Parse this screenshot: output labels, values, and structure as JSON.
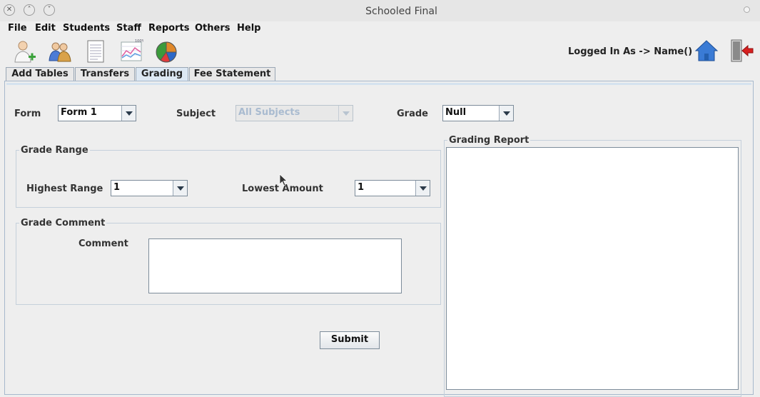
{
  "window": {
    "title": "Schooled Final"
  },
  "menu": [
    "File",
    "Edit",
    "Students",
    "Staff",
    "Reports",
    "Others",
    "Help"
  ],
  "toolbar": {
    "icons": [
      "add-user-icon",
      "users-icon",
      "document-icon",
      "chart-icon",
      "pie-chart-icon"
    ],
    "logged_in": "Logged In As -> Name()"
  },
  "tabs": [
    "Add Tables",
    "Transfers",
    "Grading",
    "Fee Statement"
  ],
  "active_tab": "Grading",
  "filters": {
    "form_label": "Form",
    "form_value": "Form 1",
    "subject_label": "Subject",
    "subject_value": "All Subjects",
    "grade_label": "Grade",
    "grade_value": "Null"
  },
  "grade_range": {
    "title": "Grade Range",
    "highest_label": "Highest Range",
    "highest_value": "1",
    "lowest_label": "Lowest Amount",
    "lowest_value": "1"
  },
  "grade_comment": {
    "title": "Grade Comment",
    "comment_label": "Comment",
    "comment_value": ""
  },
  "submit_label": "Submit",
  "report": {
    "title": "Grading Report"
  }
}
